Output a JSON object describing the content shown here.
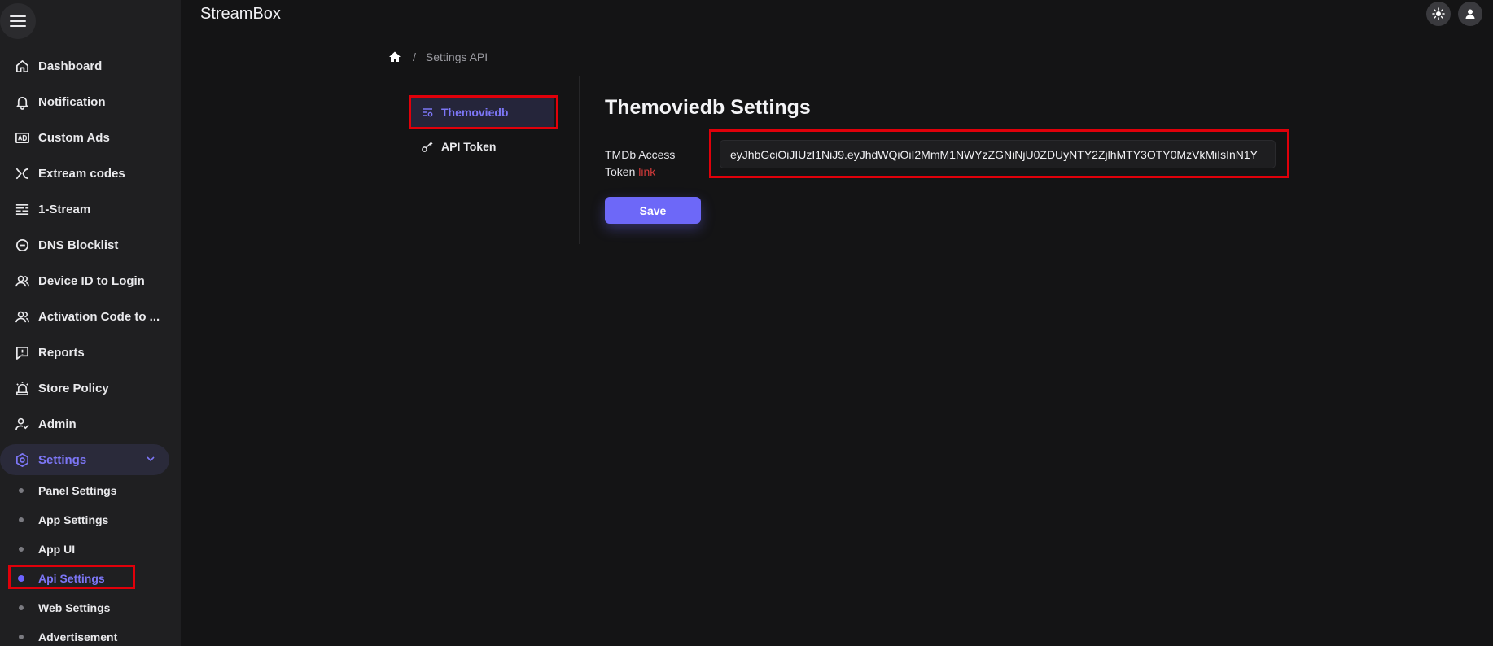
{
  "app": {
    "title": "StreamBox"
  },
  "sidebar": {
    "items": [
      {
        "label": "Dashboard",
        "icon": "home-icon"
      },
      {
        "label": "Notification",
        "icon": "bell-icon"
      },
      {
        "label": "Custom Ads",
        "icon": "ad-icon"
      },
      {
        "label": "Extream codes",
        "icon": "xtream-icon"
      },
      {
        "label": "1-Stream",
        "icon": "list-icon"
      },
      {
        "label": "DNS Blocklist",
        "icon": "block-icon"
      },
      {
        "label": "Device ID to Login",
        "icon": "users-icon"
      },
      {
        "label": "Activation Code to ...",
        "icon": "users-icon"
      },
      {
        "label": "Reports",
        "icon": "report-icon"
      },
      {
        "label": "Store Policy",
        "icon": "siren-icon"
      },
      {
        "label": "Admin",
        "icon": "admin-icon"
      },
      {
        "label": "Settings",
        "icon": "settings-icon",
        "active": true
      }
    ],
    "sub_items": [
      {
        "label": "Panel Settings"
      },
      {
        "label": "App Settings"
      },
      {
        "label": "App UI"
      },
      {
        "label": "Api Settings",
        "active": true
      },
      {
        "label": "Web Settings"
      },
      {
        "label": "Advertisement"
      }
    ]
  },
  "breadcrumb": {
    "current": "Settings API"
  },
  "tabs": [
    {
      "label": "Themoviedb",
      "icon": "filter-settings-icon",
      "active": true
    },
    {
      "label": "API Token",
      "icon": "key-icon"
    }
  ],
  "panel": {
    "title": "Themoviedb Settings",
    "field_label": "TMDb Access Token",
    "field_link": "link",
    "token_value": "eyJhbGciOiJIUzI1NiJ9.eyJhdWQiOiI2MmM1NWYzZGNiNjU0ZDUyNTY2ZjlhMTY3OTY0MzVkMiIsInN1Y",
    "save_label": "Save"
  },
  "colors": {
    "accent": "#6d68f8",
    "highlight": "#e0000a",
    "background": "#141415",
    "sidebar": "#1f1f21"
  }
}
